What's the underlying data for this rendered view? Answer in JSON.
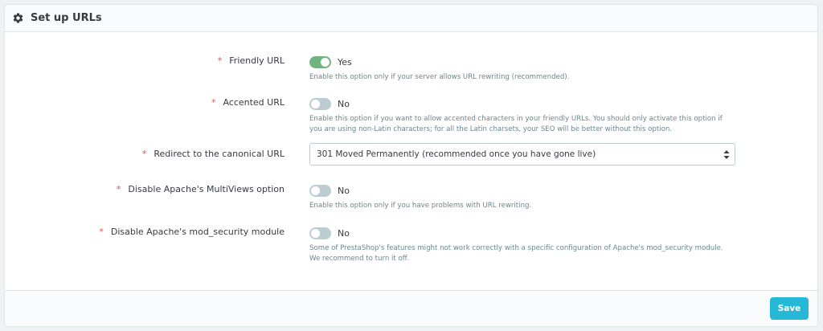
{
  "panel": {
    "title": "Set up URLs",
    "icon": "gear-icon"
  },
  "colors": {
    "accent": "#25b9d7",
    "toggle_on": "#70b580",
    "toggle_off": "#bbcdd2",
    "required": "#e84e4e"
  },
  "fields": {
    "friendly_url": {
      "required_marker": "*",
      "label": "Friendly URL",
      "enabled": true,
      "value": "Yes",
      "help": "Enable this option only if your server allows URL rewriting (recommended)."
    },
    "accented_url": {
      "required_marker": "*",
      "label": "Accented URL",
      "enabled": false,
      "value": "No",
      "help": "Enable this option if you want to allow accented characters in your friendly URLs. You should only activate this option if you are using non-Latin characters; for all the Latin charsets, your SEO will be better without this option."
    },
    "canonical_redirect": {
      "required_marker": "*",
      "label": "Redirect to the canonical URL",
      "selected": "301 Moved Permanently (recommended once you have gone live)"
    },
    "multiviews": {
      "required_marker": "*",
      "label": "Disable Apache's MultiViews option",
      "enabled": false,
      "value": "No",
      "help": "Enable this option only if you have problems with URL rewriting."
    },
    "mod_security": {
      "required_marker": "*",
      "label": "Disable Apache's mod_security module",
      "enabled": false,
      "value": "No",
      "help": "Some of PrestaShop's features might not work correctly with a specific configuration of Apache's mod_security module. We recommend to turn it off."
    }
  },
  "footer": {
    "save_label": "Save"
  }
}
